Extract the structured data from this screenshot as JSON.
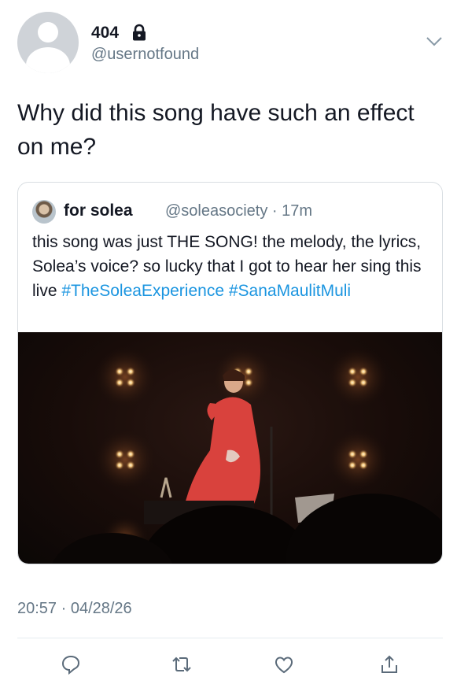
{
  "author": {
    "display_name": "404",
    "handle": "@usernotfound",
    "avatar_icon": "default-avatar-icon",
    "lock_icon": "lock-icon"
  },
  "tweet": {
    "text": "Why did this song have such an effect on me?",
    "timestamp": "20:57 · 04/28/26"
  },
  "quoted_tweet": {
    "author_name": "for solea",
    "handle_time": "@soleasociety · 17m",
    "text_plain": "this song was just THE SONG! the melody, the lyrics, Solea’s voice? so lucky that I got to hear her sing this live ",
    "hashtag_1": "#TheSoleaExperience",
    "hashtag_2": "#SanaMaulitMuli",
    "hashtag_color": "#1b95e0"
  },
  "actions": {
    "reply_icon": "reply-icon",
    "retweet_icon": "retweet-icon",
    "like_icon": "heart-icon",
    "share_icon": "share-icon"
  },
  "colors": {
    "text": "#141823",
    "secondary": "#657786",
    "border": "#d9dee2"
  }
}
